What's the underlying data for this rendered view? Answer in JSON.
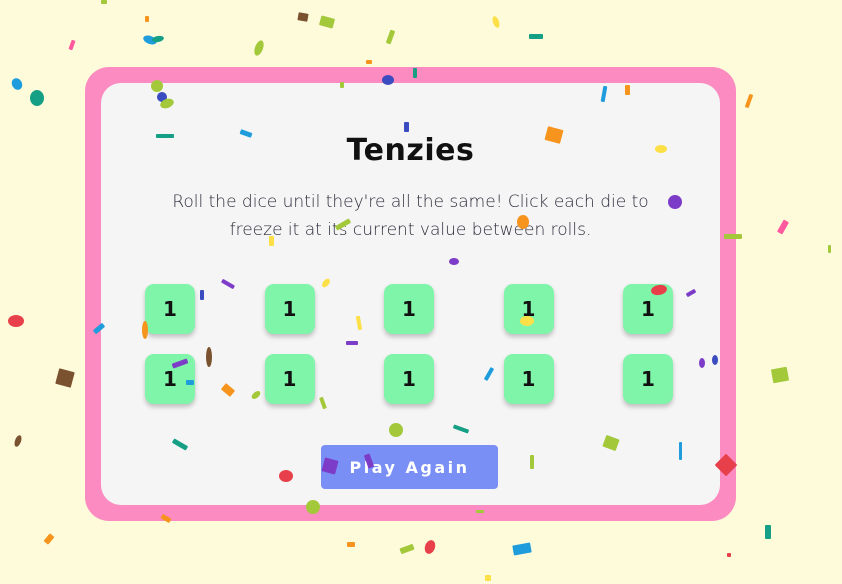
{
  "game": {
    "title": "Tenzies",
    "instructions": "Roll the dice until they're all the same! Click each die to freeze it at its current value between rolls.",
    "dice": [
      {
        "value": "1"
      },
      {
        "value": "1"
      },
      {
        "value": "1"
      },
      {
        "value": "1"
      },
      {
        "value": "1"
      },
      {
        "value": "1"
      },
      {
        "value": "1"
      },
      {
        "value": "1"
      },
      {
        "value": "1"
      },
      {
        "value": "1"
      }
    ],
    "button_label": "Play Again"
  },
  "colors": {
    "page_background": "#fdfbda",
    "card_border": "#fb8bc0",
    "card_background": "#f5f5f5",
    "die_background": "#7ef5a8",
    "button_background": "#7a8ff5",
    "confetti": [
      "#e8404a",
      "#f7941d",
      "#fde047",
      "#a3c93a",
      "#15a085",
      "#1e9cdc",
      "#3b4cc0",
      "#7d3cc8",
      "#ff5aa0",
      "#7a5230"
    ]
  }
}
